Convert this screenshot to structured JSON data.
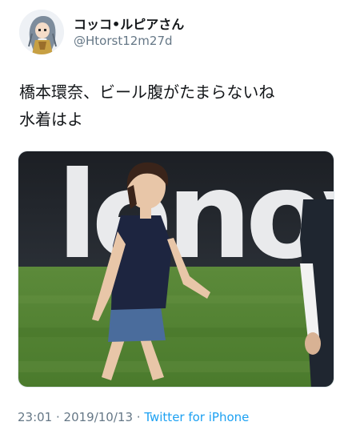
{
  "tweet": {
    "display_name": "コッコ•ルピアさん",
    "handle": "@Htorst12m27d",
    "text_lines": [
      "橋本環奈、ビール腹がたまらないね",
      "水着はよ"
    ],
    "timestamp": "23:01 · 2019/10/13",
    "separator": " · ",
    "source": "Twitter for iPhone",
    "media_banner_text": "lenovo"
  },
  "colors": {
    "link": "#1da1f2",
    "secondary_text": "#657786",
    "primary_text": "#14171a"
  },
  "icons": {
    "avatar": "anime-character-avatar"
  }
}
